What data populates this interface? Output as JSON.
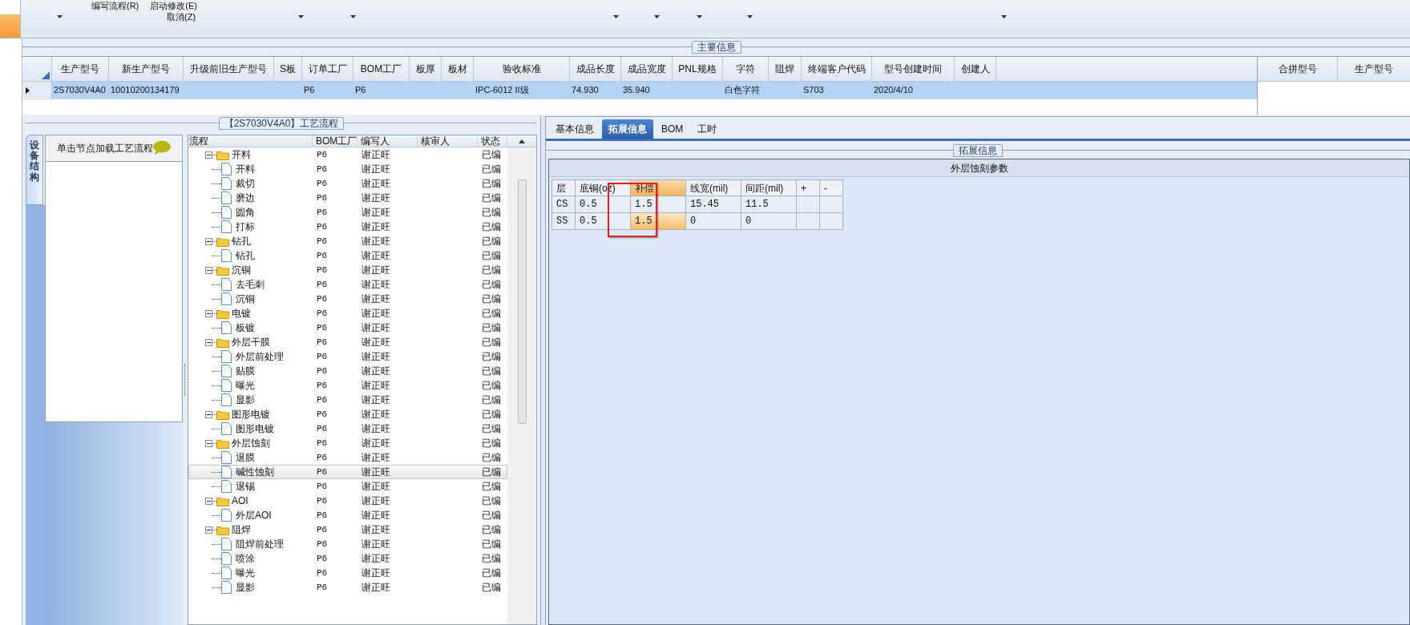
{
  "toolbar": {
    "menu_items": [
      {
        "label": "编写流程(R)"
      },
      {
        "label": "启动修改(E)"
      },
      {
        "label": "取消(Z)"
      }
    ]
  },
  "main_info": {
    "title": "主要信息",
    "columns": [
      "生产型号",
      "新生产型号",
      "升级前旧生产型号",
      "S板",
      "订单工厂",
      "BOM工厂",
      "板厚",
      "板材",
      "验收标准",
      "成品长度",
      "成品宽度",
      "PNL规格",
      "字符",
      "阻焊",
      "终端客户代码",
      "型号创建时间",
      "创建人"
    ],
    "rows": [
      {
        "selected": true,
        "cells": [
          "2S7030V4A0",
          "10010200134179",
          null,
          null,
          "P6",
          "P6",
          null,
          null,
          "IPC-6012 II级",
          "74.930",
          "35.940",
          null,
          "白色字符",
          null,
          "S703",
          "2020/4/10",
          null
        ]
      }
    ],
    "side_columns": [
      "合拼型号",
      "生产型号"
    ]
  },
  "process": {
    "title": "【2S7030V4A0】工艺流程",
    "side_tab": "设备结构",
    "hint": "单击节点加载工艺流程",
    "columns": [
      "流程",
      "BOM工厂",
      "编写人",
      "核审人",
      "状态"
    ],
    "tree": [
      {
        "label": "开料",
        "bom": "P6",
        "writer": "谢正旺",
        "status": "已编",
        "expanded": true,
        "selected": false,
        "children": [
          {
            "label": "开料",
            "bom": "P6",
            "writer": "谢正旺",
            "status": "已编",
            "selected": false
          },
          {
            "label": "裁切",
            "bom": "P6",
            "writer": "谢正旺",
            "status": "已编",
            "selected": false
          },
          {
            "label": "磨边",
            "bom": "P6",
            "writer": "谢正旺",
            "status": "已编",
            "selected": false
          },
          {
            "label": "圆角",
            "bom": "P6",
            "writer": "谢正旺",
            "status": "已编",
            "selected": false
          },
          {
            "label": "打标",
            "bom": "P6",
            "writer": "谢正旺",
            "status": "已编",
            "selected": false
          }
        ]
      },
      {
        "label": "钻孔",
        "bom": "P6",
        "writer": "谢正旺",
        "status": "已编",
        "expanded": true,
        "selected": false,
        "children": [
          {
            "label": "钻孔",
            "bom": "P6",
            "writer": "谢正旺",
            "status": "已编",
            "selected": false
          }
        ]
      },
      {
        "label": "沉铜",
        "bom": "P6",
        "writer": "谢正旺",
        "status": "已编",
        "expanded": true,
        "selected": false,
        "children": [
          {
            "label": "去毛刺",
            "bom": "P6",
            "writer": "谢正旺",
            "status": "已编",
            "selected": false
          },
          {
            "label": "沉铜",
            "bom": "P6",
            "writer": "谢正旺",
            "status": "已编",
            "selected": false
          }
        ]
      },
      {
        "label": "电镀",
        "bom": "P6",
        "writer": "谢正旺",
        "status": "已编",
        "expanded": true,
        "selected": false,
        "children": [
          {
            "label": "板镀",
            "bom": "P6",
            "writer": "谢正旺",
            "status": "已编",
            "selected": false
          }
        ]
      },
      {
        "label": "外层干膜",
        "bom": "P6",
        "writer": "谢正旺",
        "status": "已编",
        "expanded": true,
        "selected": false,
        "children": [
          {
            "label": "外层前处理",
            "bom": "P6",
            "writer": "谢正旺",
            "status": "已编",
            "selected": false
          },
          {
            "label": "贴膜",
            "bom": "P6",
            "writer": "谢正旺",
            "status": "已编",
            "selected": false
          },
          {
            "label": "曝光",
            "bom": "P6",
            "writer": "谢正旺",
            "status": "已编",
            "selected": false
          },
          {
            "label": "显影",
            "bom": "P6",
            "writer": "谢正旺",
            "status": "已编",
            "selected": false
          }
        ]
      },
      {
        "label": "图形电镀",
        "bom": "P6",
        "writer": "谢正旺",
        "status": "已编",
        "expanded": true,
        "selected": false,
        "children": [
          {
            "label": "图形电镀",
            "bom": "P6",
            "writer": "谢正旺",
            "status": "已编",
            "selected": false
          }
        ]
      },
      {
        "label": "外层蚀刻",
        "bom": "P6",
        "writer": "谢正旺",
        "status": "已编",
        "expanded": true,
        "selected": false,
        "children": [
          {
            "label": "退膜",
            "bom": "P6",
            "writer": "谢正旺",
            "status": "已编",
            "selected": false
          },
          {
            "label": "碱性蚀刻",
            "bom": "P6",
            "writer": "谢正旺",
            "status": "已编",
            "selected": true
          },
          {
            "label": "退锡",
            "bom": "P6",
            "writer": "谢正旺",
            "status": "已编",
            "selected": false
          }
        ]
      },
      {
        "label": "AOI",
        "bom": "P6",
        "writer": "谢正旺",
        "status": "已编",
        "expanded": true,
        "selected": false,
        "children": [
          {
            "label": "外层AOI",
            "bom": "P6",
            "writer": "谢正旺",
            "status": "已编",
            "selected": false
          }
        ]
      },
      {
        "label": "阻焊",
        "bom": "P6",
        "writer": "谢正旺",
        "status": "已编",
        "expanded": true,
        "selected": false,
        "children": [
          {
            "label": "阻焊前处理",
            "bom": "P6",
            "writer": "谢正旺",
            "status": "已编",
            "selected": false
          },
          {
            "label": "喷涂",
            "bom": "P6",
            "writer": "谢正旺",
            "status": "已编",
            "selected": false
          },
          {
            "label": "曝光",
            "bom": "P6",
            "writer": "谢正旺",
            "status": "已编",
            "selected": false
          },
          {
            "label": "显影",
            "bom": "P6",
            "writer": "谢正旺",
            "status": "已编",
            "selected": false
          }
        ]
      }
    ]
  },
  "detail": {
    "tabs": [
      {
        "label": "基本信息",
        "selected": false
      },
      {
        "label": "拓展信息",
        "selected": true
      },
      {
        "label": "BOM",
        "selected": false
      },
      {
        "label": "工时",
        "selected": false
      }
    ],
    "title": "拓展信息",
    "table_title": "外层蚀刻参数",
    "columns": [
      {
        "label": "层",
        "selected": false
      },
      {
        "label": "底铜(oz)",
        "selected": false
      },
      {
        "label": "补偿",
        "selected": true
      },
      {
        "label": "线宽(mil)",
        "selected": false
      },
      {
        "label": "间距(mil)",
        "selected": false
      },
      {
        "label": "+",
        "selected": false
      },
      {
        "label": "-",
        "selected": false
      }
    ],
    "rows": [
      {
        "selected": false,
        "cells": [
          "CS",
          "0.5",
          "1.5",
          "15.45",
          "11.5",
          null,
          null
        ]
      },
      {
        "selected": true,
        "cells": [
          "SS",
          "0.5",
          "1.5",
          "0",
          "0",
          null,
          null
        ]
      }
    ]
  }
}
